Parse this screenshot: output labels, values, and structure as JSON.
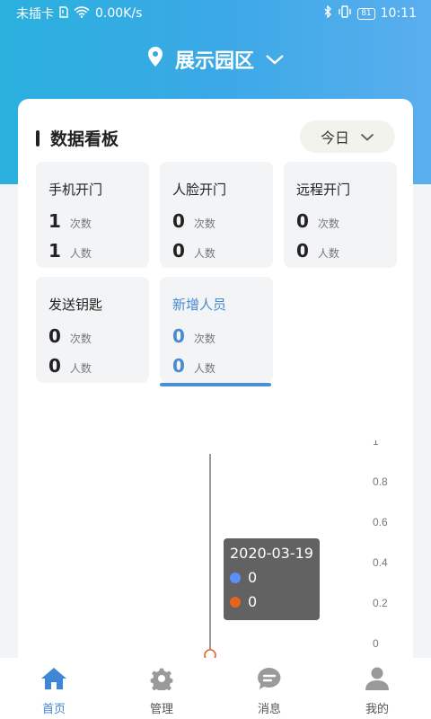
{
  "status_bar": {
    "carrier": "未插卡",
    "speed": "0.00K/s",
    "battery": "81",
    "time": "10:11"
  },
  "header": {
    "location": "展示园区"
  },
  "dashboard": {
    "title": "数据看板",
    "period": "今日",
    "stats": [
      {
        "title": "手机开门",
        "count": "1",
        "count_unit": "次数",
        "people": "1",
        "people_unit": "人数"
      },
      {
        "title": "人脸开门",
        "count": "0",
        "count_unit": "次数",
        "people": "0",
        "people_unit": "人数"
      },
      {
        "title": "远程开门",
        "count": "0",
        "count_unit": "次数",
        "people": "0",
        "people_unit": "人数"
      },
      {
        "title": "发送钥匙",
        "count": "0",
        "count_unit": "次数",
        "people": "0",
        "people_unit": "人数"
      },
      {
        "title": "新增人员",
        "count": "0",
        "count_unit": "次数",
        "people": "0",
        "people_unit": "人数"
      }
    ]
  },
  "chart_data": {
    "type": "line",
    "x": [
      "2020-03-19"
    ],
    "series": [
      {
        "values": [
          0
        ],
        "color": "#5b8ff9"
      },
      {
        "values": [
          0
        ],
        "color": "#e8641c"
      }
    ],
    "ylim": [
      0,
      1
    ],
    "y_ticks": [
      "1",
      "0.8",
      "0.6",
      "0.4",
      "0.2",
      "0"
    ],
    "tooltip": {
      "date": "2020-03-19",
      "values": [
        "0",
        "0"
      ]
    }
  },
  "tabbar": {
    "tabs": [
      {
        "label": "首页",
        "icon": "home-icon"
      },
      {
        "label": "管理",
        "icon": "gear-icon"
      },
      {
        "label": "消息",
        "icon": "message-icon"
      },
      {
        "label": "我的",
        "icon": "user-icon"
      }
    ]
  },
  "colors": {
    "accent": "#3e86d6",
    "header_start": "#2ab0de",
    "header_end": "#5aaeee"
  }
}
